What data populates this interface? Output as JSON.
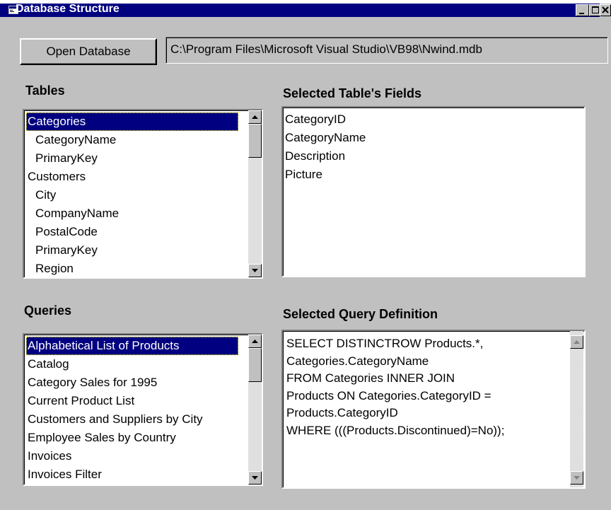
{
  "window": {
    "title": "Database Structure",
    "controls": [
      "minimize-icon",
      "maximize-icon",
      "close-icon"
    ]
  },
  "toolbar": {
    "open_button_label": "Open Database",
    "path_value": "C:\\Program Files\\Microsoft Visual Studio\\VB98\\Nwind.mdb"
  },
  "tables": {
    "label": "Tables",
    "items": [
      {
        "text": "Categories",
        "indent": false,
        "selected": true
      },
      {
        "text": "CategoryName",
        "indent": true,
        "selected": false
      },
      {
        "text": "PrimaryKey",
        "indent": true,
        "selected": false
      },
      {
        "text": "Customers",
        "indent": false,
        "selected": false
      },
      {
        "text": "City",
        "indent": true,
        "selected": false
      },
      {
        "text": "CompanyName",
        "indent": true,
        "selected": false
      },
      {
        "text": "PostalCode",
        "indent": true,
        "selected": false
      },
      {
        "text": "PrimaryKey",
        "indent": true,
        "selected": false
      },
      {
        "text": "Region",
        "indent": true,
        "selected": false
      }
    ]
  },
  "fields": {
    "label": "Selected Table's Fields",
    "items": [
      "CategoryID",
      "CategoryName",
      "Description",
      "Picture"
    ]
  },
  "queries": {
    "label": "Queries",
    "items": [
      {
        "text": "Alphabetical List of Products",
        "selected": true
      },
      {
        "text": "Catalog",
        "selected": false
      },
      {
        "text": "Category Sales for 1995",
        "selected": false
      },
      {
        "text": "Current Product List",
        "selected": false
      },
      {
        "text": "Customers and Suppliers by City",
        "selected": false
      },
      {
        "text": "Employee Sales by Country",
        "selected": false
      },
      {
        "text": "Invoices",
        "selected": false
      },
      {
        "text": "Invoices Filter",
        "selected": false
      }
    ]
  },
  "query_definition": {
    "label": "Selected Query Definition",
    "lines": [
      "SELECT DISTINCTROW Products.*,",
      "Categories.CategoryName",
      "FROM Categories INNER JOIN",
      "Products ON Categories.CategoryID =",
      "Products.CategoryID",
      "WHERE (((Products.Discontinued)=No));"
    ]
  }
}
